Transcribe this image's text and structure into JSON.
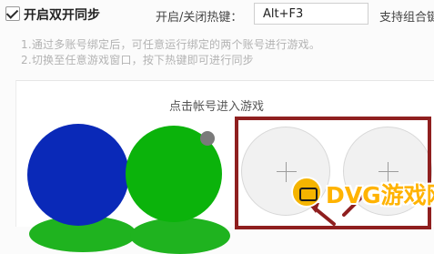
{
  "top_bar": {
    "sync_checked": true,
    "sync_label": "开启双开同步",
    "hotkey_label": "开启/关闭热键：",
    "hotkey_value": "Alt+F3",
    "combo_label": "支持组合键"
  },
  "hints": {
    "line1": "1.通过多账号绑定后，可任意运行绑定的两个账号进行游戏。",
    "line2": "2.切换至任意游戏窗口，按下热键即可进行同步"
  },
  "accounts_panel": {
    "title": "点击帐号进入游戏",
    "close_symbol": "✓",
    "add_symbol": "+",
    "avatar_colors": [
      "#0a29b8",
      "#0bb30b"
    ],
    "highlight_color": "#8f1f1f"
  },
  "watermark": {
    "text": "DVG游戏网"
  }
}
